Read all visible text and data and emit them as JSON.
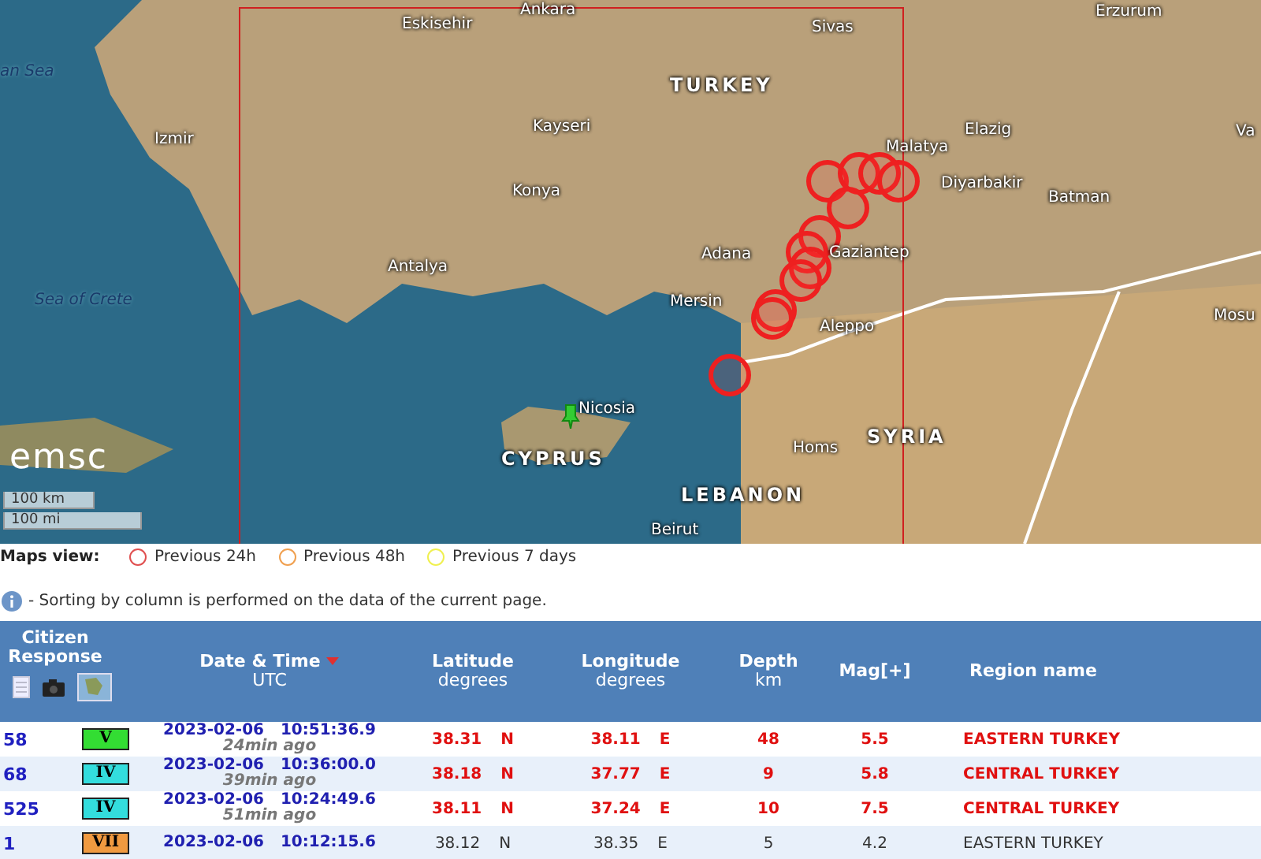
{
  "map": {
    "labels": [
      {
        "text": "an Sea",
        "kind": "sea"
      },
      {
        "text": "Eskisehir",
        "kind": "city"
      },
      {
        "text": "Ankara",
        "kind": "city"
      },
      {
        "text": "Sivas",
        "kind": "city"
      },
      {
        "text": "Erzurum",
        "kind": "city"
      },
      {
        "text": "TURKEY",
        "kind": "country"
      },
      {
        "text": "Kayseri",
        "kind": "city"
      },
      {
        "text": "Elazig",
        "kind": "city"
      },
      {
        "text": "Malatya",
        "kind": "city"
      },
      {
        "text": "Izmir",
        "kind": "city"
      },
      {
        "text": "Konya",
        "kind": "city"
      },
      {
        "text": "Diyarbakir",
        "kind": "city"
      },
      {
        "text": "Batman",
        "kind": "city"
      },
      {
        "text": "Va",
        "kind": "city"
      },
      {
        "text": "Antalya",
        "kind": "city"
      },
      {
        "text": "Adana",
        "kind": "city"
      },
      {
        "text": "Gaziantep",
        "kind": "city"
      },
      {
        "text": "Sea of Crete",
        "kind": "sea"
      },
      {
        "text": "Mersin",
        "kind": "city"
      },
      {
        "text": "Aleppo",
        "kind": "city"
      },
      {
        "text": "Mosu",
        "kind": "city"
      },
      {
        "text": "Nicosia",
        "kind": "city"
      },
      {
        "text": "SYRIA",
        "kind": "country"
      },
      {
        "text": "CYPRUS",
        "kind": "country"
      },
      {
        "text": "Homs",
        "kind": "city"
      },
      {
        "text": "LEBANON",
        "kind": "country"
      },
      {
        "text": "Beirut",
        "kind": "city"
      }
    ],
    "logo": "emsc",
    "scale": [
      "100 km",
      "100 mi"
    ]
  },
  "legend": {
    "label": "Maps view:",
    "items": [
      {
        "text": "Previous 24h",
        "color": "#e05050"
      },
      {
        "text": "Previous 48h",
        "color": "#f0a050"
      },
      {
        "text": "Previous 7 days",
        "color": "#f0f050"
      }
    ]
  },
  "note": "- Sorting by column is performed on the data of the current page.",
  "table": {
    "columns": [
      {
        "title": "Citizen Response"
      },
      {
        "title": "Date & Time",
        "sub": "UTC",
        "sorted": true
      },
      {
        "title": "Latitude",
        "sub": "degrees"
      },
      {
        "title": "Longitude",
        "sub": "degrees"
      },
      {
        "title": "Depth",
        "sub": "km"
      },
      {
        "title": "Mag[+]"
      },
      {
        "title": "Region name"
      }
    ],
    "rows": [
      {
        "responses": "58",
        "intensity": "V",
        "color": "#33dd33",
        "date": "2023-02-06",
        "time": "10:51:36.9",
        "ago": "24min ago",
        "lat": "38.31",
        "ns": "N",
        "lon": "38.11",
        "ew": "E",
        "depth": "48",
        "mag": "5.5",
        "region": "EASTERN TURKEY",
        "highlight": true
      },
      {
        "responses": "68",
        "intensity": "IV",
        "color": "#33dddd",
        "date": "2023-02-06",
        "time": "10:36:00.0",
        "ago": "39min ago",
        "lat": "38.18",
        "ns": "N",
        "lon": "37.77",
        "ew": "E",
        "depth": "9",
        "mag": "5.8",
        "region": "CENTRAL TURKEY",
        "highlight": true
      },
      {
        "responses": "525",
        "intensity": "IV",
        "color": "#33dddd",
        "date": "2023-02-06",
        "time": "10:24:49.6",
        "ago": "51min ago",
        "lat": "38.11",
        "ns": "N",
        "lon": "37.24",
        "ew": "E",
        "depth": "10",
        "mag": "7.5",
        "region": "CENTRAL TURKEY",
        "highlight": true
      },
      {
        "responses": "1",
        "intensity": "VII",
        "color": "#f09a40",
        "date": "2023-02-06",
        "time": "10:12:15.6",
        "lat": "38.12",
        "ns": "N",
        "lon": "38.35",
        "ew": "E",
        "depth": "5",
        "mag": "4.2",
        "region": "EASTERN TURKEY",
        "highlight": false
      }
    ]
  }
}
